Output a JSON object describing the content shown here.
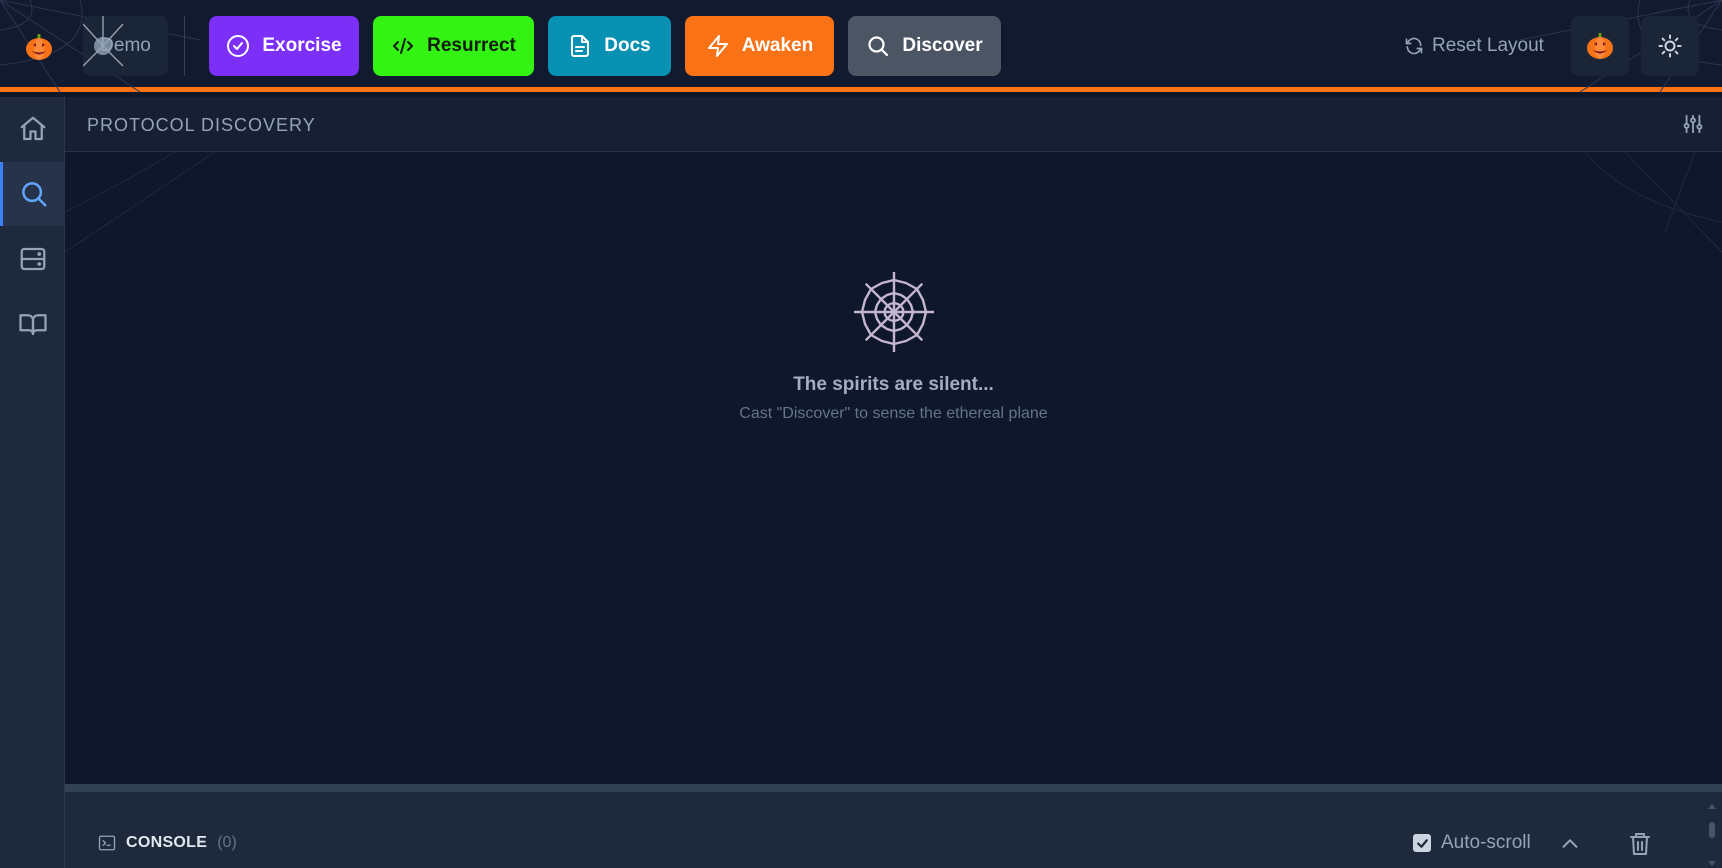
{
  "topbar": {
    "demo_label": "Demo",
    "actions": {
      "exorcise": "Exorcise",
      "resurrect": "Resurrect",
      "docs": "Docs",
      "awaken": "Awaken",
      "discover": "Discover"
    },
    "reset_label": "Reset Layout"
  },
  "sidebar": {
    "items": [
      {
        "name": "home",
        "icon": "home-icon"
      },
      {
        "name": "discover",
        "icon": "search-icon",
        "active": true
      },
      {
        "name": "servers",
        "icon": "server-icon"
      },
      {
        "name": "docs",
        "icon": "book-icon"
      }
    ]
  },
  "panel": {
    "title": "PROTOCOL DISCOVERY",
    "empty_title": "The spirits are silent...",
    "empty_subtitle": "Cast \"Discover\" to sense the ethereal plane"
  },
  "console": {
    "label": "CONSOLE",
    "count": "(0)",
    "autoscroll_label": "Auto-scroll",
    "autoscroll_checked": true
  },
  "colors": {
    "accent": "#f97316",
    "exorcise": "#7c2ff7",
    "resurrect": "#33f312",
    "docs": "#0891b2",
    "awaken": "#f97316",
    "discover": "#4b5563",
    "active_indicator": "#3b82f6"
  }
}
